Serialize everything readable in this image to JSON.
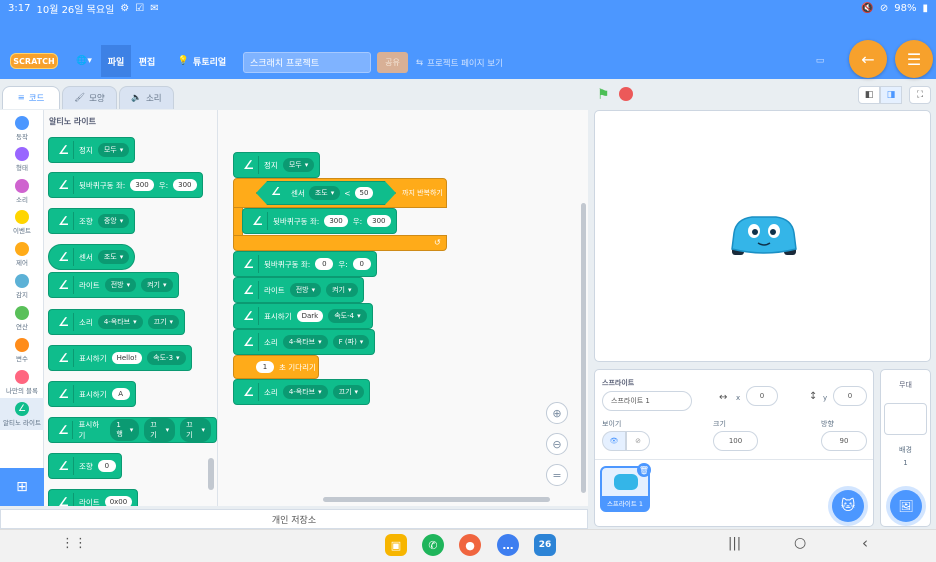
{
  "status": {
    "time": "3:17",
    "date": "10월 26일 목요일",
    "battery": "98%"
  },
  "menu": {
    "file": "파일",
    "edit": "편집",
    "tutorial": "튜토리얼",
    "project_title": "스크래치 프로젝트",
    "share": "공유",
    "see_project": "프로젝트 페이지 보기"
  },
  "tabs": {
    "code": "코드",
    "costume": "모양",
    "sound": "소리"
  },
  "categories": [
    {
      "label": "동작",
      "color": "#4c97ff"
    },
    {
      "label": "형태",
      "color": "#9966ff"
    },
    {
      "label": "소리",
      "color": "#cf63cf"
    },
    {
      "label": "이벤트",
      "color": "#ffd500"
    },
    {
      "label": "제어",
      "color": "#ffab19"
    },
    {
      "label": "감지",
      "color": "#5cb1d6"
    },
    {
      "label": "연산",
      "color": "#59c059"
    },
    {
      "label": "변수",
      "color": "#ff8c1a"
    },
    {
      "label": "나만의 블록",
      "color": "#ff6680"
    },
    {
      "label": "알티노 라이트",
      "color": "#0fbd8c"
    }
  ],
  "palette": {
    "title": "알티노 라이트",
    "b1": {
      "label": "정지",
      "dd": "모두"
    },
    "b2": {
      "label": "뒷바퀴구동 좌:",
      "v1": "300",
      "mid": "우:",
      "v2": "300"
    },
    "b3": {
      "label": "조향",
      "dd": "중앙"
    },
    "b4": {
      "label": "센서",
      "dd": "조도"
    },
    "b5": {
      "label": "라이트",
      "dd1": "전방",
      "dd2": "켜기"
    },
    "b6": {
      "label": "소리",
      "dd1": "4-옥타브",
      "dd2": "끄기"
    },
    "b7": {
      "label": "표시하기",
      "v": "Hello!",
      "dd": "속도-3"
    },
    "b8": {
      "label": "표시하기",
      "v": "A"
    },
    "b9": {
      "label": "표시하기",
      "dd1": "1행",
      "dd2": "끄기",
      "dd3": "끄기"
    },
    "b10": {
      "label": "조향",
      "v": "0"
    },
    "b11": {
      "label": "라이트",
      "v": "0x00"
    }
  },
  "script": {
    "s1": {
      "label": "정지",
      "dd": "모두"
    },
    "loop": {
      "sensor": "센서",
      "sensor_dd": "조도",
      "op": "<",
      "val": "50",
      "until": "까지 반복하기"
    },
    "s2": {
      "label": "뒷바퀴구동 좌:",
      "v1": "300",
      "mid": "우:",
      "v2": "300"
    },
    "s3": {
      "label": "뒷바퀴구동 좌:",
      "v1": "0",
      "mid": "우:",
      "v2": "0"
    },
    "s4": {
      "label": "라이트",
      "dd1": "전방",
      "dd2": "켜기"
    },
    "s5": {
      "label": "표시하기",
      "v": "Dark",
      "dd": "속도-4"
    },
    "s6": {
      "label": "소리",
      "dd1": "4-옥타브",
      "dd2": "F (파)"
    },
    "wait": {
      "v": "1",
      "label": "초 기다리기"
    },
    "s7": {
      "label": "소리",
      "dd1": "4-옥타브",
      "dd2": "끄기"
    }
  },
  "save": "개인 저장소",
  "sprite": {
    "header": "스프라이트",
    "name": "스프라이트 1",
    "x_label": "x",
    "x": "0",
    "y_label": "y",
    "y": "0",
    "show_label": "보이기",
    "size_label": "크기",
    "size": "100",
    "dir_label": "방향",
    "dir": "90",
    "thumb_label": "스프라이트 1"
  },
  "stage_pane": {
    "title": "무대",
    "backdrop_label": "배경",
    "backdrop_count": "1"
  }
}
